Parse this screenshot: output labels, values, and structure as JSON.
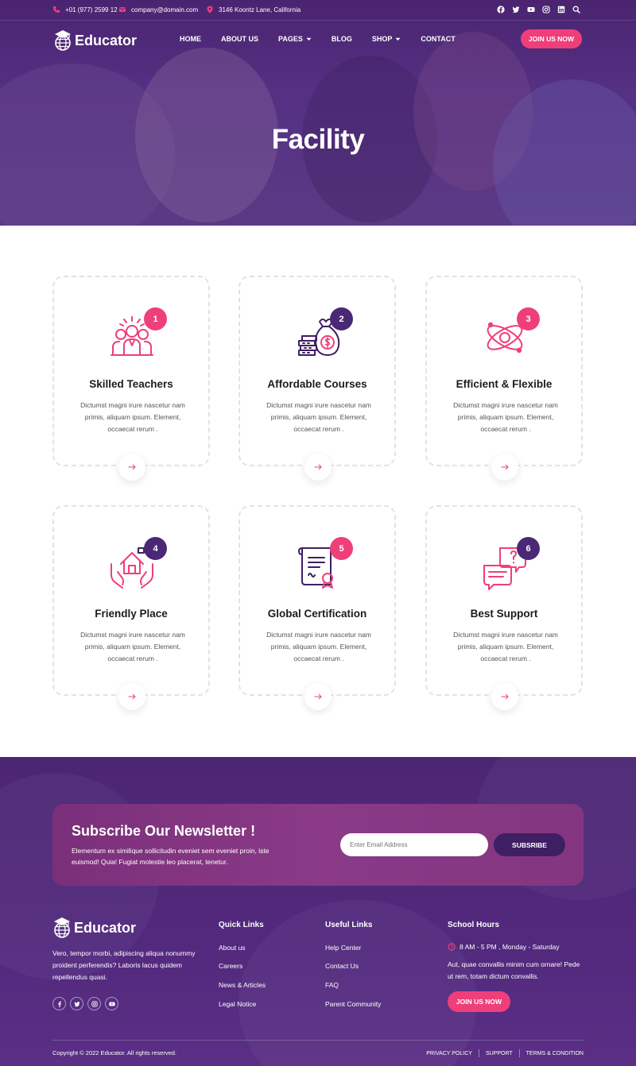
{
  "topbar": {
    "phone": "+01 (977) 2599 12",
    "email": "company@domain.com",
    "address": "3146 Koontz Lane, California",
    "social_icons": [
      "facebook-icon",
      "twitter-icon",
      "youtube-icon",
      "instagram-icon",
      "linkedin-icon",
      "search-icon"
    ]
  },
  "brand": {
    "name": "Educator"
  },
  "nav": {
    "items": [
      {
        "label": "HOME",
        "dropdown": false
      },
      {
        "label": "ABOUT US",
        "dropdown": false
      },
      {
        "label": "PAGES",
        "dropdown": true
      },
      {
        "label": "BLOG",
        "dropdown": false
      },
      {
        "label": "SHOP",
        "dropdown": true
      },
      {
        "label": "CONTACT",
        "dropdown": false
      }
    ],
    "cta": "JOIN US NOW"
  },
  "hero": {
    "title": "Facility"
  },
  "colors": {
    "accent": "#ef3f7a",
    "primary": "#4a2875"
  },
  "features": [
    {
      "number": "1",
      "title": "Skilled Teachers",
      "desc": "Dictumst magni irure nascetur nam primis, aliquam ipsum. Element, occaecat rerum .",
      "icon": "teachers-icon",
      "badge": "pink"
    },
    {
      "number": "2",
      "title": "Affordable Courses",
      "desc": "Dictumst magni irure nascetur nam primis, aliquam ipsum. Element, occaecat rerum .",
      "icon": "money-bag-icon",
      "badge": "purple"
    },
    {
      "number": "3",
      "title": "Efficient & Flexible",
      "desc": "Dictumst magni irure nascetur nam primis, aliquam ipsum. Element, occaecat rerum .",
      "icon": "atom-icon",
      "badge": "pink"
    },
    {
      "number": "4",
      "title": "Friendly Place",
      "desc": "Dictumst magni irure nascetur nam primis, aliquam ipsum. Element, occaecat rerum .",
      "icon": "house-hands-icon",
      "badge": "purple"
    },
    {
      "number": "5",
      "title": "Global Certification",
      "desc": "Dictumst magni irure nascetur nam primis, aliquam ipsum. Element, occaecat rerum .",
      "icon": "certificate-icon",
      "badge": "pink"
    },
    {
      "number": "6",
      "title": "Best Support",
      "desc": "Dictumst magni irure nascetur nam primis, aliquam ipsum. Element, occaecat rerum .",
      "icon": "chat-support-icon",
      "badge": "purple"
    }
  ],
  "newsletter": {
    "title": "Subscribe Our Newsletter !",
    "text": "Elementum ex similique sollicitudin eveniet sem eveniet proin, iste euismod! Quia! Fugiat molestie leo placerat, tenetur.",
    "placeholder": "Enter Email Address",
    "button": "SUBSRIBE"
  },
  "footer": {
    "about": "Vero, tempor morbi, adipiscing aliqua nonummy proident perferendis? Laboris lacus quidem repellendus quasi.",
    "social_icons": [
      "facebook-icon",
      "twitter-icon",
      "instagram-icon",
      "youtube-icon"
    ],
    "quick_links": {
      "title": "Quick Links",
      "items": [
        "About us",
        "Careers",
        "News & Articles",
        "Legal Notice"
      ]
    },
    "useful_links": {
      "title": "Useful Links",
      "items": [
        "Help Center",
        "Contact Us",
        "FAQ",
        "Parent Community"
      ]
    },
    "hours": {
      "title": "School Hours",
      "time": "8 AM - 5 PM , Monday - Saturday",
      "text": "Aut, quae convallis minim cum ornare! Pede ut rem, totam dictum convallis.",
      "cta": "JOIN US NOW"
    },
    "copyright": "Copyright © 2022 Educator. All rights reserved.",
    "legal": [
      "PRIVACY POLICY",
      "SUPPORT",
      "TERMS & CONDITION"
    ]
  }
}
